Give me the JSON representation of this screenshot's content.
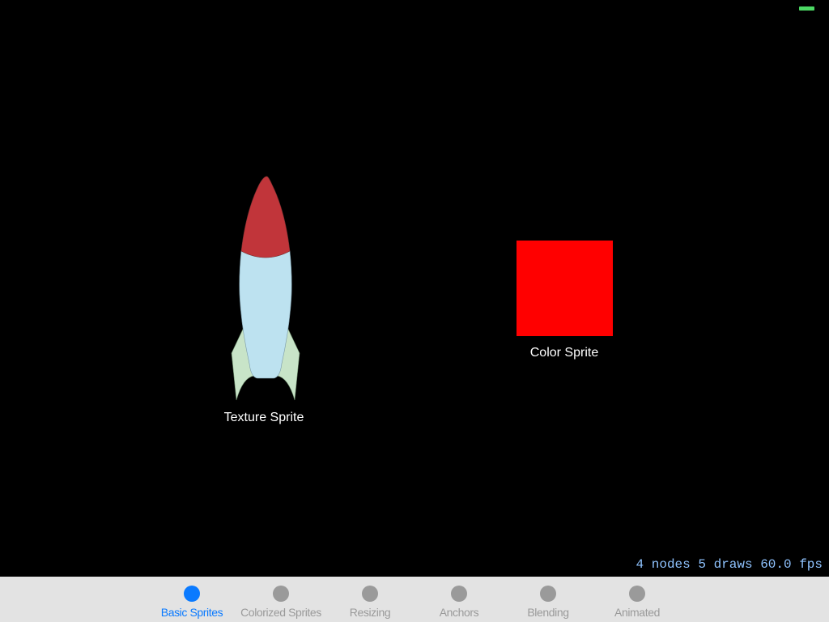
{
  "colors": {
    "scene_background": "#000000",
    "tabbar_background": "#e3e3e3",
    "tab_active": "#0a7aff",
    "tab_inactive_dot": "#9a9a9a",
    "tab_inactive_label": "#9a9a9a",
    "stats_text": "#8fc3ff",
    "battery": "#4cd964",
    "color_sprite": "#ff0000",
    "label_text": "#ffffff",
    "rocket_nose": "#c1353a",
    "rocket_body": "#bde2f0",
    "rocket_fins": "#c8e4c8"
  },
  "scene": {
    "texture_sprite": {
      "label": "Texture Sprite",
      "image": "rocket-sprite"
    },
    "color_sprite": {
      "label": "Color Sprite"
    }
  },
  "stats": {
    "nodes": "4 nodes",
    "draws": "5 draws",
    "fps": "60.0 fps"
  },
  "tabbar": {
    "active_index": 0,
    "tabs": [
      {
        "label": "Basic Sprites",
        "icon": "circle-icon"
      },
      {
        "label": "Colorized Sprites",
        "icon": "circle-icon"
      },
      {
        "label": "Resizing",
        "icon": "circle-icon"
      },
      {
        "label": "Anchors",
        "icon": "circle-icon"
      },
      {
        "label": "Blending",
        "icon": "circle-icon"
      },
      {
        "label": "Animated",
        "icon": "circle-icon"
      }
    ]
  }
}
